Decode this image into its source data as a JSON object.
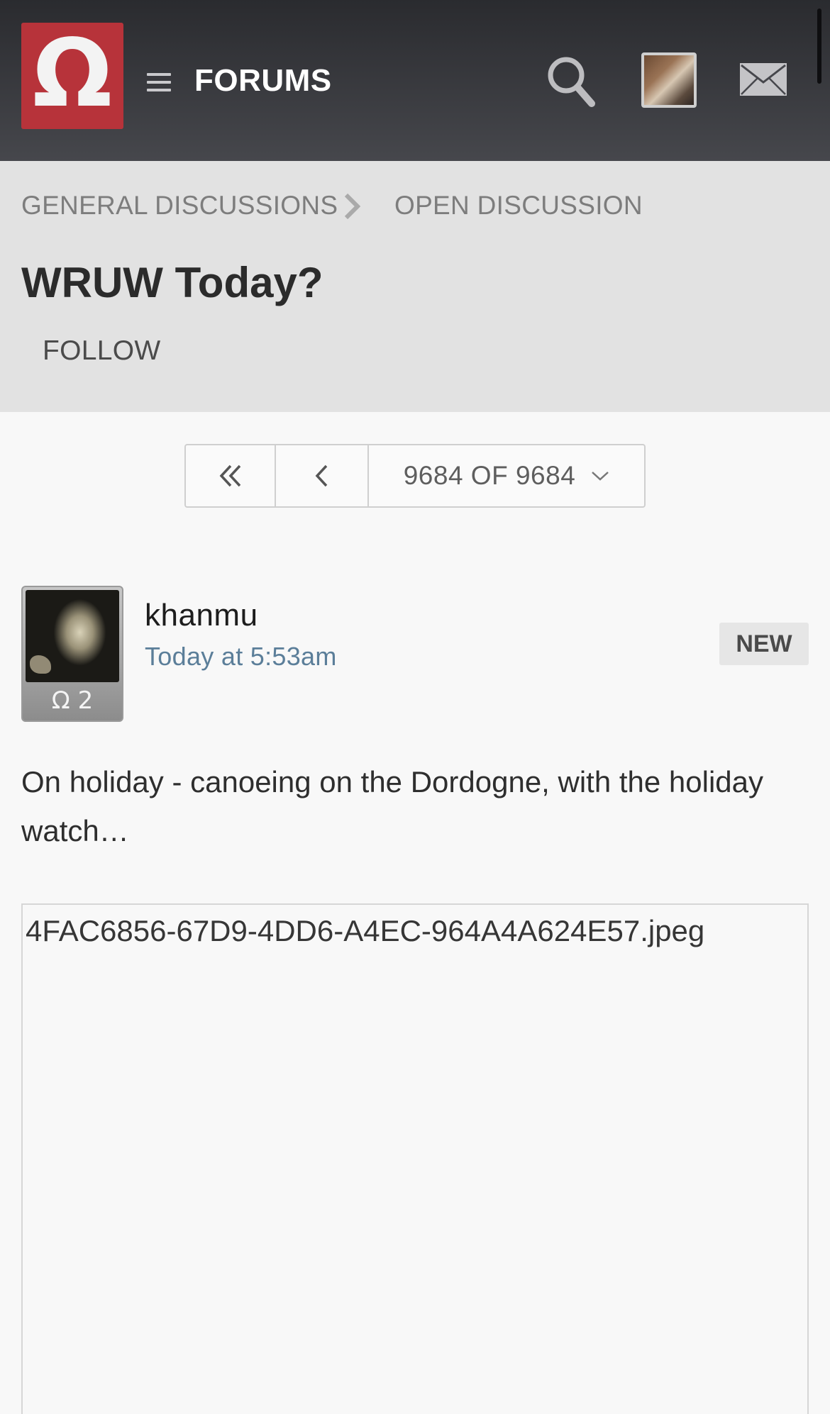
{
  "header": {
    "logo_glyph": "Ω",
    "forums_label": "FORUMS",
    "icons": [
      "omega-logo",
      "hamburger-menu-icon",
      "search-icon",
      "user-avatar",
      "mail-icon"
    ]
  },
  "breadcrumb": {
    "items": [
      "GENERAL DISCUSSIONS",
      "OPEN DISCUSSION"
    ]
  },
  "thread": {
    "title": "WRUW Today?",
    "follow_label": "FOLLOW"
  },
  "pagination": {
    "current_label": "9684 OF 9684"
  },
  "post": {
    "author": "khanmu",
    "rank": "Ω 2",
    "timestamp": "Today at 5:53am",
    "badge": "NEW",
    "body": "On holiday - canoeing on the Dordogne, with the holiday watch…",
    "attachment_name": "4FAC6856-67D9-4DD6-A4EC-964A4A624E57.jpeg"
  },
  "colors": {
    "header_top": "#2a2b2f",
    "header_bottom": "#46474c",
    "logo_red": "#b7333a",
    "title_area_bg": "#e2e2e2",
    "timestamp_blue": "#5b7e99"
  }
}
